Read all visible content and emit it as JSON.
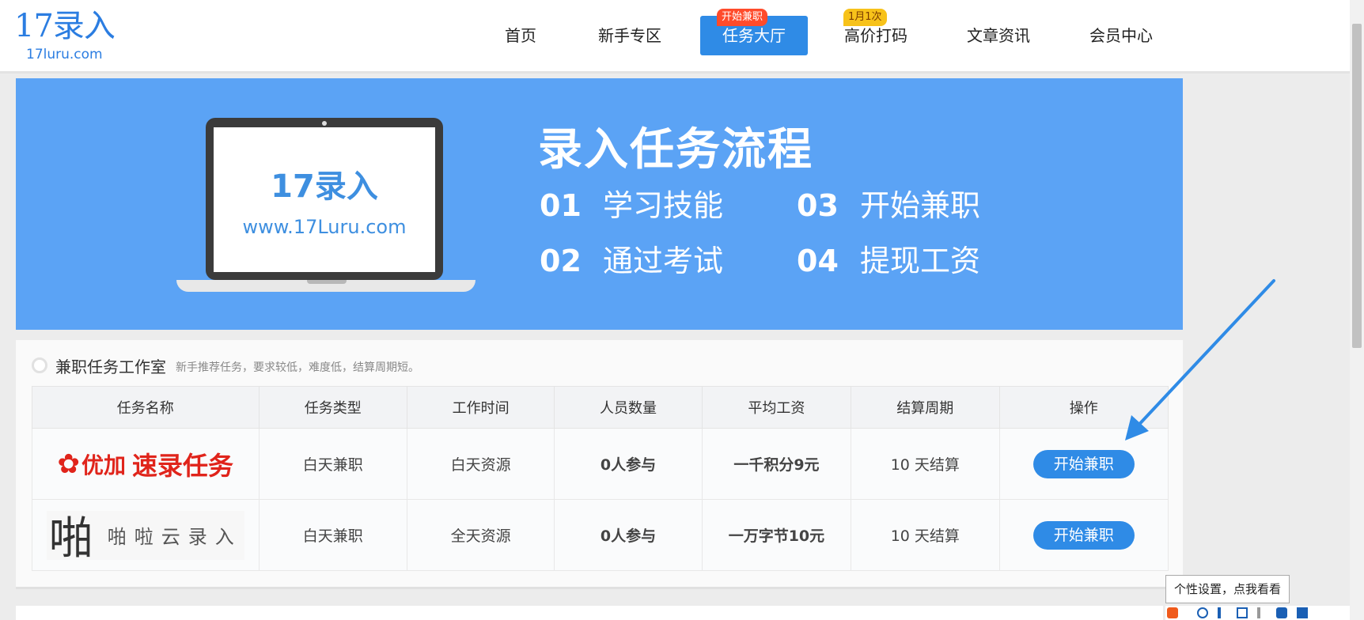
{
  "logo": {
    "main": "17录入",
    "sub": "17luru.com"
  },
  "nav": {
    "items": [
      {
        "label": "首页"
      },
      {
        "label": "新手专区"
      },
      {
        "label": "任务大厅",
        "badge": "开始兼职"
      },
      {
        "label": "高价打码",
        "badge": "1月1次"
      },
      {
        "label": "文章资讯"
      },
      {
        "label": "会员中心"
      }
    ]
  },
  "banner": {
    "screen_title": "17录入",
    "screen_url": "www.17Luru.com",
    "title": "录入任务流程",
    "steps": [
      {
        "no": "01",
        "text": "学习技能"
      },
      {
        "no": "02",
        "text": "通过考试"
      },
      {
        "no": "03",
        "text": "开始兼职"
      },
      {
        "no": "04",
        "text": "提现工资"
      }
    ]
  },
  "panel": {
    "title": "兼职任务工作室",
    "desc": "新手推荐任务，要求较低，难度低，结算周期短。",
    "columns": [
      "任务名称",
      "任务类型",
      "工作时间",
      "人员数量",
      "平均工资",
      "结算周期",
      "操作"
    ],
    "rows": [
      {
        "logo_a": "优加",
        "logo_b": "速录任务",
        "type": "白天兼职",
        "time": "白天资源",
        "people": "0人参与",
        "salary": "一千积分9元",
        "cycle": "10 天结算",
        "action": "开始兼职"
      },
      {
        "logo_a": "啪",
        "logo_b": "啪啦云录入",
        "type": "白天兼职",
        "time": "全天资源",
        "people": "0人参与",
        "salary": "一万字节10元",
        "cycle": "10 天结算",
        "action": "开始兼职"
      }
    ]
  },
  "tooltip": "个性设置，点我看看",
  "colors": {
    "accent": "#2f8be6",
    "banner": "#5ba3f5",
    "salary": "#f05a1b",
    "logo_red": "#e0241b"
  }
}
